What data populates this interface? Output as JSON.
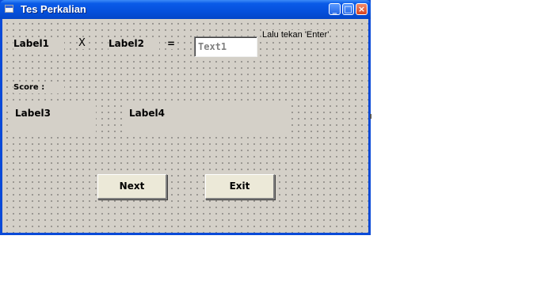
{
  "window": {
    "title": "Tes Perkalian",
    "controls": {
      "minimize": "_",
      "maximize": "□",
      "close": "×"
    }
  },
  "form": {
    "label1": "Label1",
    "operator": "X",
    "label2": "Label2",
    "equals": "=",
    "answer_input": "Text1",
    "hint": "Lalu tekan 'Enter'",
    "score_label": "Score  :",
    "label3": "Label3",
    "label4": "Label4",
    "next_button": "Next",
    "exit_button": "Exit"
  },
  "colors": {
    "title_bar": "#0550dc",
    "form_background": "#d4d0c8",
    "button_face": "#ece9d8"
  },
  "icons": {
    "app": "form-icon",
    "minimize": "minimize-icon",
    "maximize": "maximize-icon",
    "close": "close-icon"
  }
}
